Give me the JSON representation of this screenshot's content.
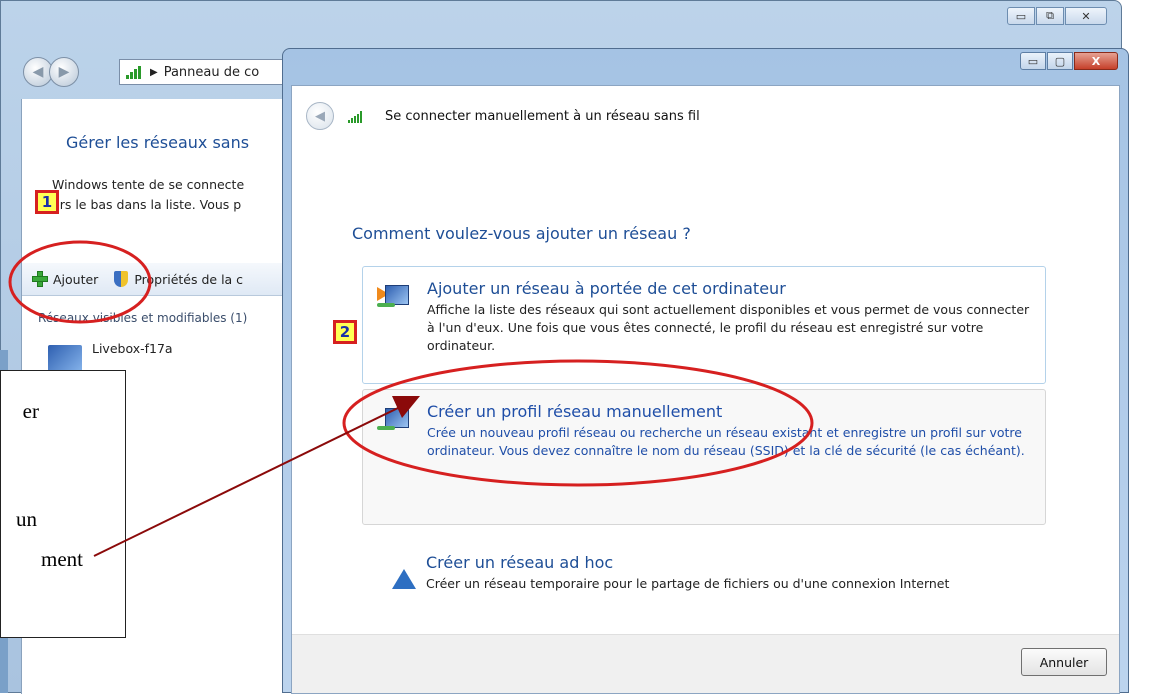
{
  "background_window": {
    "address": "Panneau de co",
    "title": "Gérer les réseaux sans",
    "description_line1": "Windows tente de se connecte",
    "description_line2": "ers le bas dans la liste. Vous p",
    "toolbar_add": "Ajouter",
    "toolbar_properties": "Propriétés de la c",
    "section_label": "Réseaux visibles et modifiables (1)",
    "network_name": "Livebox-f17a",
    "caption_minimize": "▭",
    "caption_maximize": "⧉",
    "caption_close": "✕"
  },
  "dialog": {
    "title": "Se connecter manuellement à un réseau sans fil",
    "question": "Comment voulez-vous ajouter un réseau ?",
    "options": [
      {
        "title": "Ajouter un réseau à portée de cet ordinateur",
        "description": "Affiche la liste des réseaux qui sont actuellement disponibles et vous permet de vous connecter à l'un d'eux. Une fois que vous êtes connecté, le profil du réseau est enregistré sur votre ordinateur."
      },
      {
        "title": "Créer un profil réseau manuellement",
        "description": "Crée un nouveau profil réseau ou recherche un réseau existant et enregistre un profil sur votre ordinateur. Vous devez connaître le nom du réseau (SSID) et la clé de sécurité (le cas échéant)."
      },
      {
        "title": "Créer un réseau ad hoc",
        "description": "Créer un réseau temporaire pour le partage de fichiers ou d'une connexion Internet"
      }
    ],
    "cancel_label": "Annuler",
    "caption_minimize": "▭",
    "caption_maximize": "▢",
    "caption_close": "X"
  },
  "annotations": {
    "badge1": "1",
    "badge2": "2",
    "callout_line1": "er",
    "callout_line2": "un",
    "callout_line3": "ment"
  },
  "colors": {
    "accent_blue": "#1e4e96",
    "highlight_red": "#d62020",
    "arrow_darkred": "#8b0a0a",
    "badge_yellow": "#ffff55"
  }
}
